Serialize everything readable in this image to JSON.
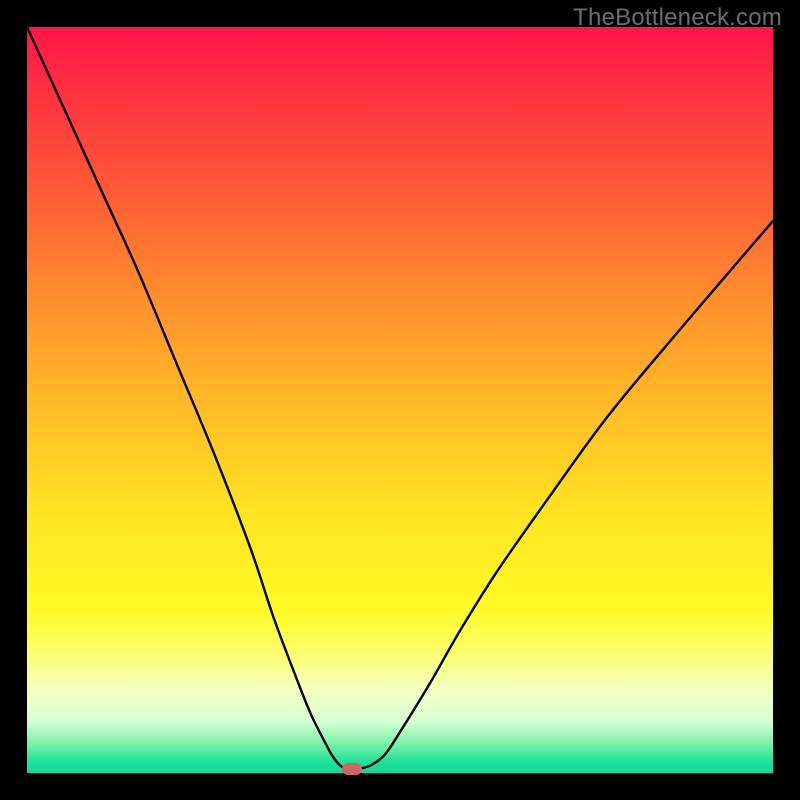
{
  "watermark": "TheBottleneck.com",
  "chart_data": {
    "type": "line",
    "title": "",
    "xlabel": "",
    "ylabel": "",
    "xlim": [
      0,
      100
    ],
    "ylim": [
      0,
      100
    ],
    "grid": false,
    "series": [
      {
        "name": "bottleneck-curve",
        "x": [
          0,
          5,
          10,
          15,
          20,
          25,
          30,
          33,
          36,
          38,
          40,
          41,
          42,
          43,
          44,
          46,
          48,
          50,
          54,
          58,
          63,
          70,
          78,
          88,
          100
        ],
        "values": [
          100,
          89,
          78,
          67,
          55,
          43,
          30,
          21,
          13,
          8,
          4,
          2.2,
          1.0,
          0.5,
          0.5,
          1.0,
          2.5,
          5.5,
          12,
          19,
          27,
          37,
          48,
          60,
          74
        ]
      }
    ],
    "annotations": [
      {
        "name": "optimal-point",
        "x": 43.5,
        "y": 0.5
      }
    ],
    "colors": {
      "curve": "#000000",
      "marker": "#cb685f",
      "gradient_top": "#ff1548",
      "gradient_bottom": "#14da97"
    }
  }
}
